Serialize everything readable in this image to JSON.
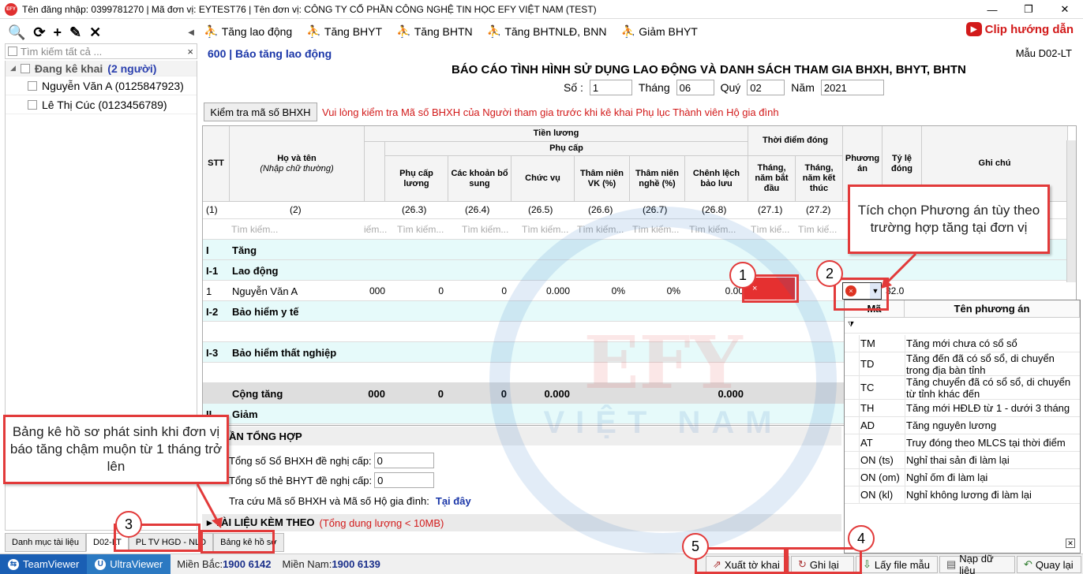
{
  "title_bar": {
    "logo": "EFY",
    "text": "Tên đăng nhập: 0399781270 | Mã đơn vị: EYTEST76 | Tên đơn vị: CÔNG TY CỔ PHẦN CÔNG NGHỆ TIN HỌC EFY VIỆT NAM (TEST)",
    "minimize": "—",
    "maximize": "❐",
    "close": "✕"
  },
  "left_panel": {
    "toolbar": {
      "search": "🔍",
      "refresh": "⟳",
      "add": "+",
      "edit": "✎",
      "delete": "✕",
      "collapse": "◀"
    },
    "search_placeholder": "Tìm kiếm tất cả ...",
    "search_clear": "×",
    "group": {
      "label": "Đang kê khai",
      "count": "(2 người)"
    },
    "people": [
      "Nguyễn Văn A (0125847923)",
      "Lê Thị Cúc (0123456789)"
    ]
  },
  "left_tabs": [
    "Danh mục tài liệu",
    "D02-LT",
    "PL TV HGD - NLD",
    "Bảng kê hồ sơ"
  ],
  "toolbar": [
    {
      "label": "Tăng lao động"
    },
    {
      "label": "Tăng BHYT"
    },
    {
      "label": "Tăng BHTN"
    },
    {
      "label": "Tăng BHTNLĐ, BNN"
    },
    {
      "label": "Giảm BHYT"
    }
  ],
  "clip_label": "Clip hướng dẫn",
  "form": {
    "code_title": "600 | Báo tăng lao động",
    "template": "Mẫu D02-LT",
    "report_title": "BÁO CÁO TÌNH HÌNH SỬ DỤNG LAO ĐỘNG VÀ DANH SÁCH THAM GIA BHXH, BHYT, BHTN",
    "so_label": "Số :",
    "so_value": "1",
    "thang_label": "Tháng",
    "thang_value": "06",
    "quy_label": "Quý",
    "quy_value": "02",
    "nam_label": "Năm",
    "nam_value": "2021"
  },
  "check_button": "Kiểm tra mã số BHXH",
  "warning": "Vui lòng kiểm tra Mã số BHXH của Người tham gia trước khi kê khai Phụ lục Thành viên Hộ gia đình",
  "grid": {
    "headers": {
      "stt": "STT",
      "name": "Họ và tên",
      "name_sub": "(Nhập chữ thường)",
      "tien_luong": "Tiền lương",
      "phu_cap": "Phụ cấp",
      "pc_luong": "Phụ cấp lương",
      "khoan_bs": "Các khoản bổ sung",
      "chuc_vu": "Chức vụ",
      "tn_vk": "Thâm niên VK (%)",
      "tn_nghe": "Thâm niên nghề (%)",
      "chenh_lech": "Chênh lệch bảo lưu",
      "thoi_diem": "Thời điểm đóng",
      "bat_dau": "Tháng, năm bắt đầu",
      "ket_thuc": "Tháng, năm kết thúc",
      "phuong_an": "Phương án",
      "ty_le": "Tỷ lệ đóng",
      "ghi_chu": "Ghi chú"
    },
    "index_row": [
      "(1)",
      "(2)",
      "(26.3)",
      "(26.4)",
      "(26.5)",
      "(26.6)",
      "(26.7)",
      "(26.8)",
      "(27.1)",
      "(27.2)"
    ],
    "search_hint": "Tìm kiếm...",
    "search_short": "Tìm kiế...",
    "search_tiny": "iếm...",
    "sections": {
      "tang_code": "I",
      "tang": "Tăng",
      "lao_dong_code": "I-1",
      "lao_dong": "Lao động",
      "bhyt_code": "I-2",
      "bhyt": "Bảo hiểm y tế",
      "bhtn_code": "I-3",
      "bhtn": "Bảo hiểm thất nghiệp",
      "cong_tang": "Cộng tăng",
      "giam_code": "II",
      "giam": "Giảm"
    },
    "row1": {
      "stt": "1",
      "name": "Nguyễn Văn A",
      "luong": "000",
      "pc_luong": "0",
      "khoan_bs": "0",
      "chuc_vu": "0.000",
      "tn_vk": "0%",
      "tn_nghe": "0%",
      "chenh_lech": "0.00",
      "ty_le": "32.0",
      "red_mark": "×"
    },
    "total": {
      "luong": "000",
      "pc_luong": "0",
      "khoan_bs": "0",
      "chuc_vu": "0.000",
      "chenh_lech": "0.000"
    }
  },
  "combo": {
    "error_icon": "×",
    "arrow": "▼"
  },
  "dropdown": {
    "col_code": "Mã",
    "col_name": "Tên phương án",
    "filter_icon": "⧩",
    "close": "✕",
    "options": [
      {
        "code": "TM",
        "name": "Tăng mới chưa có sổ sổ"
      },
      {
        "code": "TD",
        "name": "Tăng đến đã có sổ sổ, di chuyển trong địa bàn tỉnh"
      },
      {
        "code": "TC",
        "name": "Tăng chuyển đã có sổ sổ, di chuyển từ tỉnh khác đến"
      },
      {
        "code": "TH",
        "name": "Tăng mới HĐLĐ từ 1 - dưới 3 tháng"
      },
      {
        "code": "AD",
        "name": "Tăng nguyên lương"
      },
      {
        "code": "AT",
        "name": "Truy đóng theo MLCS tại thời điểm"
      },
      {
        "code": "ON (ts)",
        "name": "Nghỉ thai sản đi làm lại"
      },
      {
        "code": "ON (om)",
        "name": "Nghỉ ốm đi làm lại"
      },
      {
        "code": "ON (kl)",
        "name": "Nghỉ không lương đi làm lại"
      }
    ]
  },
  "summary": {
    "header": "ẦN TỔNG HỢP",
    "so_bhxh_label": "Tổng số Sổ BHXH đề nghị cấp:",
    "so_bhxh_value": "0",
    "the_bhyt_label": "Tổng số thẻ BHYT đề nghị cấp:",
    "the_bhyt_value": "0",
    "tra_cuu": "Tra cứu Mã số BHXH và Mã số Hộ gia đình:",
    "tai_day": "Tại đây",
    "tai_lieu": "▸ TÀI LIỆU KÈM THEO",
    "tai_lieu_note": "(Tổng dung lượng < 10MB)"
  },
  "status_bar": {
    "teamviewer": "TeamViewer",
    "ultraviewer": "UltraViewer",
    "mien_bac": "Miền Bắc:",
    "mien_bac_phone": "1900 6142",
    "mien_nam": "Miền Nam:",
    "mien_nam_phone": "1900 6139"
  },
  "bottom_buttons": [
    "Xuất tờ khai",
    "Ghi lại",
    "Lấy file mẫu",
    "Nạp dữ liệu",
    "Quay lại"
  ],
  "annotations": {
    "callout_right": "Tích chọn Phương án tùy theo trường hợp tăng tại đơn vị",
    "callout_left": "Bảng kê hồ sơ phát sinh khi đơn vị báo tăng chậm muộn từ 1 tháng trở lên",
    "badges": [
      "1",
      "2",
      "3",
      "4",
      "5"
    ]
  },
  "watermark": {
    "main": "EFY",
    "sub": "VIỆT NAM"
  },
  "colors": {
    "accent_red": "#e23a3a",
    "title_blue": "#1a36a8",
    "cyan_row": "#e6fafa",
    "teamviewer_blue": "#1a5fb4"
  }
}
